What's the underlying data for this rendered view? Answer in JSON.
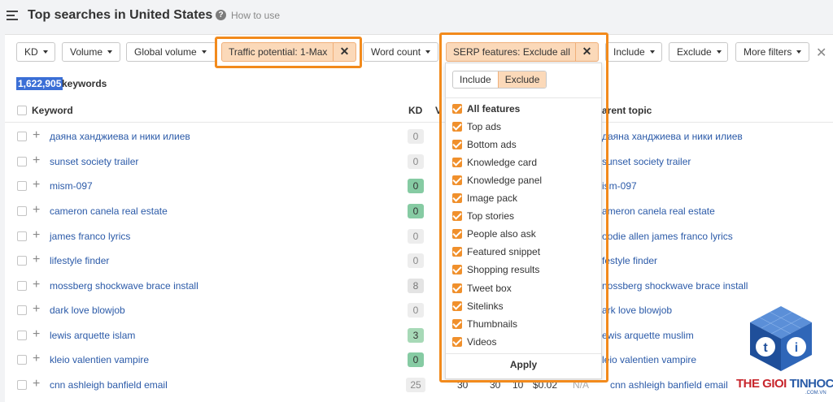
{
  "header": {
    "title": "Top searches in United States",
    "help_icon": "question-circle-icon",
    "help_label": "How to use"
  },
  "filters": {
    "kd": "KD",
    "volume": "Volume",
    "global_volume": "Global volume",
    "traffic_potential": "Traffic potential: 1-Max",
    "word_count": "Word count",
    "serp_features": "SERP features: Exclude all",
    "include": "Include",
    "exclude": "Exclude",
    "more_filters": "More filters"
  },
  "count": {
    "value": "1,622,905",
    "label": "keywords"
  },
  "table": {
    "headers": {
      "keyword": "Keyword",
      "kd": "KD",
      "volume_partial": "V",
      "parent_partial": "arent topic"
    },
    "rows": [
      {
        "keyword": "даяна ханджиева и ники илиев",
        "kd": "0",
        "parent": "даяна ханджиева и ники илиев"
      },
      {
        "keyword": "sunset society trailer",
        "kd": "0",
        "parent": "sunset society trailer"
      },
      {
        "keyword": "mism-097",
        "kd": "0",
        "parent": "ism-097"
      },
      {
        "keyword": "cameron canela real estate",
        "kd": "0",
        "parent": "ameron canela real estate"
      },
      {
        "keyword": "james franco lyrics",
        "kd": "0",
        "parent": "oodie allen james franco lyrics"
      },
      {
        "keyword": "lifestyle finder",
        "kd": "0",
        "parent": "festyle finder"
      },
      {
        "keyword": "mossberg shockwave brace install",
        "kd": "8",
        "parent": "nossberg shockwave brace install"
      },
      {
        "keyword": "dark love blowjob",
        "kd": "0",
        "parent": "ark love blowjob"
      },
      {
        "keyword": "lewis arquette islam",
        "kd": "3",
        "parent": "ewis arquette muslim"
      },
      {
        "keyword": "kleio valentien vampire",
        "kd": "0",
        "parent": "leio valentien vampire"
      },
      {
        "keyword": "cnn ashleigh banfield email",
        "kd": "25",
        "parent": "cnn ashleigh banfield email"
      }
    ],
    "last_row_extra": {
      "volume": "30",
      "global": "30",
      "tp": "10",
      "cpc": "$0.02",
      "na": "N/A"
    }
  },
  "serp_dropdown": {
    "include_tab": "Include",
    "exclude_tab": "Exclude",
    "options": [
      "All features",
      "Top ads",
      "Bottom ads",
      "Knowledge card",
      "Knowledge panel",
      "Image pack",
      "Top stories",
      "People also ask",
      "Featured snippet",
      "Shopping results",
      "Tweet box",
      "Sitelinks",
      "Thumbnails",
      "Videos"
    ],
    "apply": "Apply"
  },
  "watermark": {
    "part1": "THE GIOI ",
    "part2": "TINHOC",
    "sub": ".COM.VN"
  },
  "colors": {
    "accent_orange": "#f28a1c",
    "active_filter": "#fbd9b9",
    "link_blue": "#2b5aa8",
    "kd_green": "#86cba3"
  }
}
